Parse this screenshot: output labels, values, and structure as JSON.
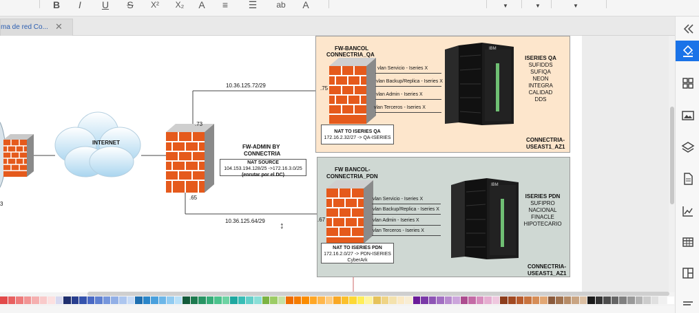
{
  "tab": {
    "title": "ma de red Co...",
    "close": "✕"
  },
  "toolbar": {
    "bold": "B",
    "italic": "I",
    "underline": "U",
    "strike": "S",
    "superscript": "X²",
    "subscript": "X₂",
    "font_color": "A",
    "line_spacing": "≡",
    "list": "☰",
    "text_style": "ab",
    "text_effect": "A"
  },
  "diagram": {
    "qa": {
      "fw_title_1": "FW-BANCOL",
      "fw_title_2": "CONNECTRIA_QA",
      "vlans": [
        "vlan Servicio - Iseries X",
        "vlan Backup/Replica - Iseries X",
        "vlan Admin - Iseries X",
        "vlan Terceros - Iseries X"
      ],
      "nat_title": "NAT TO ISERIES QA",
      "nat_rule": "172.16.2.32/27 -> QA-ISERIES",
      "server_lines": [
        "ISERIES QA",
        "SUFIDDS",
        "SUFIQA",
        "NEON",
        "INTEGRA",
        "CALIDAD",
        "DDS"
      ],
      "region_1": "CONNECTRIA-",
      "region_2": "USEAST1_AZ1",
      "port": ".75"
    },
    "pdn": {
      "fw_title_1": "FW BANCOL-",
      "fw_title_2": "CONNECTRIA_PDN",
      "vlans": [
        "vlan Servicio - Iseries X",
        "vlan Backup/Replica - Iseries X",
        "vlan Admin - Iseries X",
        "vlan Terceros - Iseries X"
      ],
      "nat_title": "NAT TO ISERIES PDN",
      "nat_rule": "172.16.2.0/27 -> PDN-ISERIES",
      "nat_extra": "CyberArk",
      "server_lines": [
        "ISERIES PDN",
        "SUFIPRO",
        "NACIONAL",
        "FINACLE",
        "HIPOTECARIO"
      ],
      "region_1": "CONNECTRIA-",
      "region_2": "USEAST1_AZ1",
      "port": ".67"
    },
    "internet": "INTERNET",
    "fw_admin_1": "FW-ADMIN BY",
    "fw_admin_2": "CONNECTRIA",
    "nat_source_title": "NAT SOURCE",
    "nat_source_rule": "104.153.194.128/25 ->172.16.3.0/25",
    "nat_source_note": "(enrutar por el DC)",
    "link_top": "10.36.125.72/29",
    "link_bottom": "10.36.125.64/29",
    "port_73": ".73",
    "port_65": ".65",
    "server_brand": "IBM",
    "left_edge_label": "3"
  },
  "right_panel": {
    "icons": [
      "collapse-icon",
      "paint-bucket-icon",
      "grid-icon",
      "image-icon",
      "layers-icon",
      "document-icon",
      "chart-icon",
      "table-icon",
      "layout-icon",
      "menu-icon"
    ],
    "accent": "#1a73e8"
  },
  "palette": {
    "colors": [
      "#e24a4a",
      "#e86060",
      "#ee7b7b",
      "#f29595",
      "#f5b0b0",
      "#f9caca",
      "#fce0e0",
      "#d7d9f0",
      "#1f2f6e",
      "#2a3f8f",
      "#3553ad",
      "#4a69c4",
      "#5f80d1",
      "#7797dc",
      "#92afe6",
      "#adc6ef",
      "#c7dbf7",
      "#1f6fb0",
      "#2b86c9",
      "#4aa0dd",
      "#6cb6e8",
      "#91cbf1",
      "#b8e0f8",
      "#135a3a",
      "#1d7a4f",
      "#289463",
      "#36ad78",
      "#4cc38d",
      "#6dd3a3",
      "#1fa8a0",
      "#38bdb6",
      "#62cfc9",
      "#8adfd8",
      "#7cb342",
      "#9ccc65",
      "#c5e1a5",
      "#ef6c00",
      "#f57c00",
      "#fb8c00",
      "#ffa726",
      "#ffb74d",
      "#ffcc80",
      "#f9a825",
      "#fbc02d",
      "#fdd835",
      "#ffee58",
      "#fff59d",
      "#e6c25a",
      "#efd486",
      "#f4e2ad",
      "#fbe9c4",
      "#f8edd4",
      "#6a1b9a",
      "#7b3aa8",
      "#8e55b5",
      "#a26fc2",
      "#b88bcf",
      "#cca6dc",
      "#ad4d8f",
      "#c46ba6",
      "#d78cbd",
      "#e6aed1",
      "#efc8df",
      "#8d3d1c",
      "#a24a22",
      "#b85c2e",
      "#c9743f",
      "#d68d57",
      "#e2a774",
      "#8a5a3c",
      "#a0724f",
      "#b68c67",
      "#c9a583",
      "#dbbfa3",
      "#1a1a1a",
      "#333333",
      "#4d4d4d",
      "#666666",
      "#808080",
      "#999999",
      "#b3b3b3",
      "#cccccc",
      "#e0e0e0",
      "#f0f0f0",
      "#ffffff"
    ]
  }
}
